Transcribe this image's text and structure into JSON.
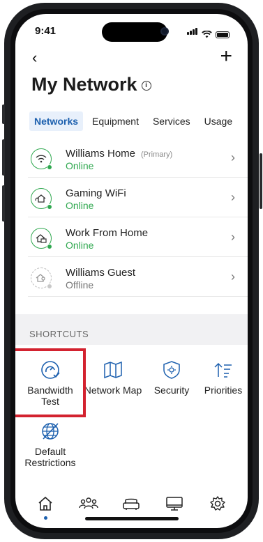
{
  "status": {
    "time": "9:41"
  },
  "header": {
    "back_label": "‹",
    "add_label": "+",
    "title": "My Network"
  },
  "tabs": [
    {
      "label": "Networks",
      "active": true
    },
    {
      "label": "Equipment",
      "active": false
    },
    {
      "label": "Services",
      "active": false
    },
    {
      "label": "Usage",
      "active": false
    }
  ],
  "networks": [
    {
      "name": "Williams Home",
      "tag": "(Primary)",
      "status": "Online",
      "icon": "wifi-icon"
    },
    {
      "name": "Gaming WiFi",
      "tag": "",
      "status": "Online",
      "icon": "gaming-network-icon"
    },
    {
      "name": "Work From Home",
      "tag": "",
      "status": "Online",
      "icon": "work-network-icon"
    },
    {
      "name": "Williams Guest",
      "tag": "",
      "status": "Offline",
      "icon": "guest-network-icon"
    }
  ],
  "shortcuts": {
    "label": "SHORTCUTS",
    "items": [
      {
        "label": "Bandwidth Test",
        "icon": "speedometer-icon"
      },
      {
        "label": "Network Map",
        "icon": "map-icon"
      },
      {
        "label": "Security",
        "icon": "shield-icon"
      },
      {
        "label": "Priorities",
        "icon": "priorities-icon"
      },
      {
        "label": "Default Restrictions",
        "icon": "restrictions-globe-icon"
      }
    ]
  },
  "nav": [
    "home-icon",
    "people-icon",
    "sofa-icon",
    "monitor-icon",
    "gear-icon"
  ],
  "colors": {
    "accent": "#1b5fae",
    "online": "#2fa84f",
    "highlight": "#d3222f"
  }
}
